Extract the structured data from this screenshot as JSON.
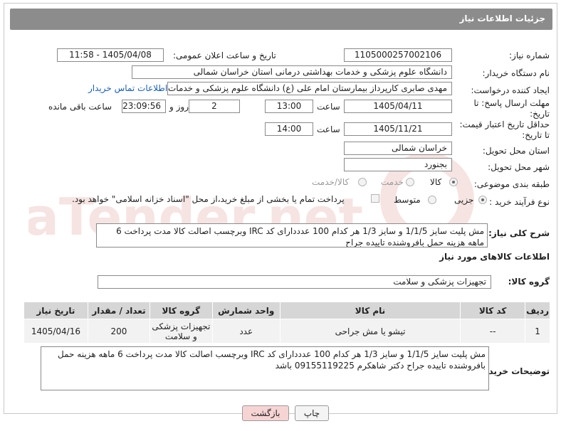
{
  "header": {
    "title": "جزئیات اطلاعات نیاز"
  },
  "fields": {
    "need_number": {
      "label": "شماره نیاز:",
      "value": "1105000257002106"
    },
    "announce": {
      "label": "تاریخ و ساعت اعلان عمومی:",
      "value": "1405/04/08 - 11:58"
    },
    "buyer": {
      "label": "نام دستگاه خریدار:",
      "value": "دانشگاه علوم پزشکی و خدمات بهداشتی درمانی استان خراسان شمالی"
    },
    "creator": {
      "label": "ایجاد کننده درخواست:",
      "value": "مهدی صابری کارپرداز بیمارستان امام علی (ع) دانشگاه علوم پزشکی و خدمات ب",
      "contact_link": "اطلاعات تماس خریدار"
    },
    "deadline": {
      "label": "مهلت ارسال پاسخ: تا تاریخ:",
      "date": "1405/04/11",
      "time_label": "ساعت",
      "time": "13:00",
      "days": "2",
      "days_label": "روز و",
      "remaining": "23:09:56",
      "remaining_label": "ساعت باقی مانده"
    },
    "validity": {
      "label": "حداقل تاریخ اعتبار قیمت: تا تاریخ:",
      "date": "1405/11/21",
      "time_label": "ساعت",
      "time": "14:00"
    },
    "province": {
      "label": "استان محل تحویل:",
      "value": "خراسان شمالی"
    },
    "city": {
      "label": "شهر محل تحویل:",
      "value": "بجنورد"
    },
    "category": {
      "label": "طبقه بندی موضوعی:",
      "options": [
        "کالا",
        "خدمت",
        "کالا/خدمت"
      ],
      "selected": "کالا"
    },
    "process": {
      "label": "نوع فرآیند خرید :",
      "options": [
        "جزیی",
        "متوسط"
      ],
      "selected": "جزیی",
      "payment_note": "پرداخت تمام یا بخشی از مبلغ خرید،از محل \"اسناد خزانه اسلامی\" خواهد بود."
    }
  },
  "description": {
    "label": "شرح کلی نیاز:",
    "value": "مش پلیت سایز 1/1/5 و سایز 1/3 هر کدام 100 عدددارای کد IRC وبرچسب اصالت کالا مدت پرداخت 6 ماهه هزینه حمل بافروشنده تاییده جراح"
  },
  "goods_section": {
    "title": "اطلاعات کالاهای مورد نیاز",
    "group_label": "گروه کالا:",
    "group_value": "تجهیزات پزشکی و سلامت"
  },
  "table": {
    "headers": [
      "ردیف",
      "کد کالا",
      "نام کالا",
      "واحد شمارش",
      "گروه کالا",
      "تعداد / مقدار",
      "تاریخ نیاز"
    ],
    "rows": [
      [
        "1",
        "--",
        "تیشو یا مش جراحی",
        "عدد",
        "تجهیزات پزشکی و سلامت",
        "200",
        "1405/04/16"
      ]
    ]
  },
  "buyer_notes": {
    "label": "توضیحات خریدار:",
    "value": "مش پلیت سایز 1/1/5 و سایز 1/3 هر کدام 100 عدددارای کد IRC وبرچسب اصالت کالا مدت پرداخت 6 ماهه هزینه حمل بافروشنده تاییده جراح دکتر شاهکرم 09155119225 باشد"
  },
  "buttons": {
    "print": "چاپ",
    "back": "بازگشت"
  },
  "watermark": "AriaTender.net"
}
